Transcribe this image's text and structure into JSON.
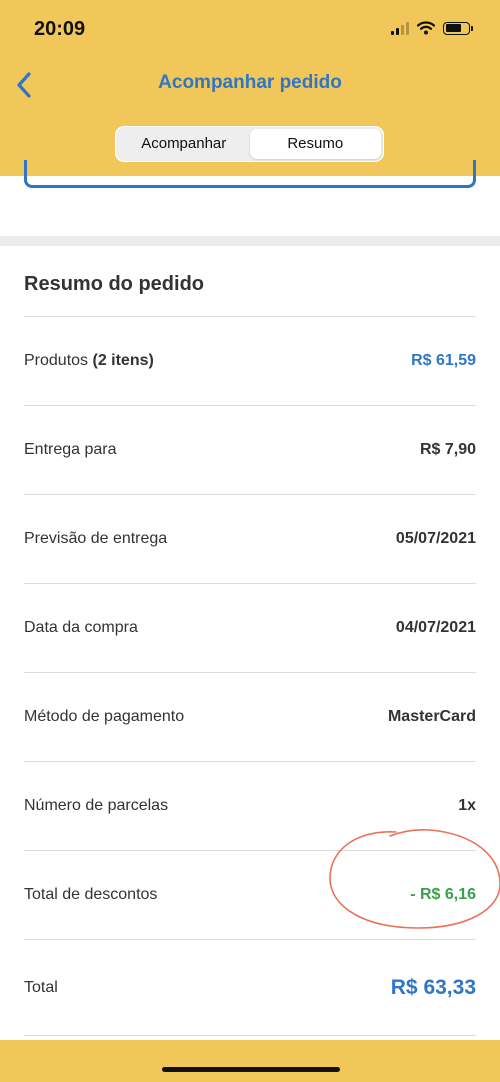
{
  "status_bar": {
    "time": "20:09"
  },
  "nav": {
    "title": "Acompanhar pedido"
  },
  "tabs": [
    {
      "label": "Acompanhar",
      "active": false
    },
    {
      "label": "Resumo",
      "active": true
    }
  ],
  "summary": {
    "title": "Resumo do pedido",
    "products_label": "Produtos ",
    "products_count": "(2 itens)",
    "products_value": "R$  61,59",
    "delivery_label": "Entrega para",
    "delivery_value": "R$  7,90",
    "forecast_label": "Previsão de entrega",
    "forecast_value": "05/07/2021",
    "purchase_date_label": "Data da compra",
    "purchase_date_value": "04/07/2021",
    "payment_label": "Método de pagamento",
    "payment_value": "MasterCard",
    "installments_label": "Número de parcelas",
    "installments_value": "1x",
    "discounts_label": "Total de descontos",
    "discounts_value": "- R$  6,16",
    "total_label": "Total",
    "total_value": "R$  63,33"
  },
  "colors": {
    "header_bg": "#f1c75a",
    "accent_blue": "#2f77c4",
    "discount_green": "#3aa14a",
    "annotation_red": "#e8735a"
  },
  "icons": {
    "back": "chevron-left-icon",
    "signal": "signal-icon",
    "wifi": "wifi-icon",
    "battery": "battery-icon"
  }
}
